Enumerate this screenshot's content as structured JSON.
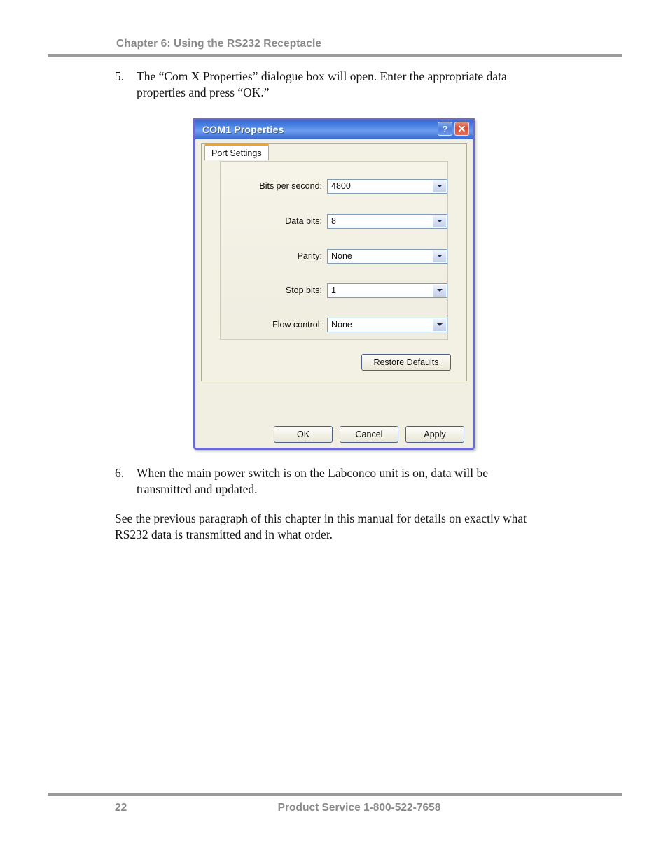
{
  "header": {
    "chapter_title": "Chapter 6: Using the RS232 Receptacle"
  },
  "body": {
    "item5": {
      "number": "5.",
      "text": "The “Com X Properties” dialogue box will open.  Enter the appropriate data properties and press “OK.”"
    },
    "item6": {
      "number": "6.",
      "text": "When the main power switch is on the Labconco unit is on, data will be transmitted and updated."
    },
    "paragraph": "See the previous paragraph of this chapter in this manual for details on exactly what RS232 data is transmitted and in what order."
  },
  "dialog": {
    "title": "COM1 Properties",
    "help_button": "?",
    "close_button": "✕",
    "tab": "Port Settings",
    "fields": [
      {
        "label": "Bits per second:",
        "value": "4800"
      },
      {
        "label": "Data bits:",
        "value": "8"
      },
      {
        "label": "Parity:",
        "value": "None"
      },
      {
        "label": "Stop bits:",
        "value": "1"
      },
      {
        "label": "Flow control:",
        "value": "None"
      }
    ],
    "restore_defaults": "Restore Defaults",
    "buttons": {
      "ok": "OK",
      "cancel": "Cancel",
      "apply": "Apply"
    },
    "colors": {
      "titlebar_blue": "#4a84e4",
      "border_blue": "#6a6ad0",
      "tab_accent_orange": "#f0a32a",
      "close_red": "#d44f36",
      "panel_beige": "#f1efe2"
    }
  },
  "footer": {
    "page_number": "22",
    "contact": "Product Service 1-800-522-7658",
    "rule_color": "#9a9a9a"
  }
}
